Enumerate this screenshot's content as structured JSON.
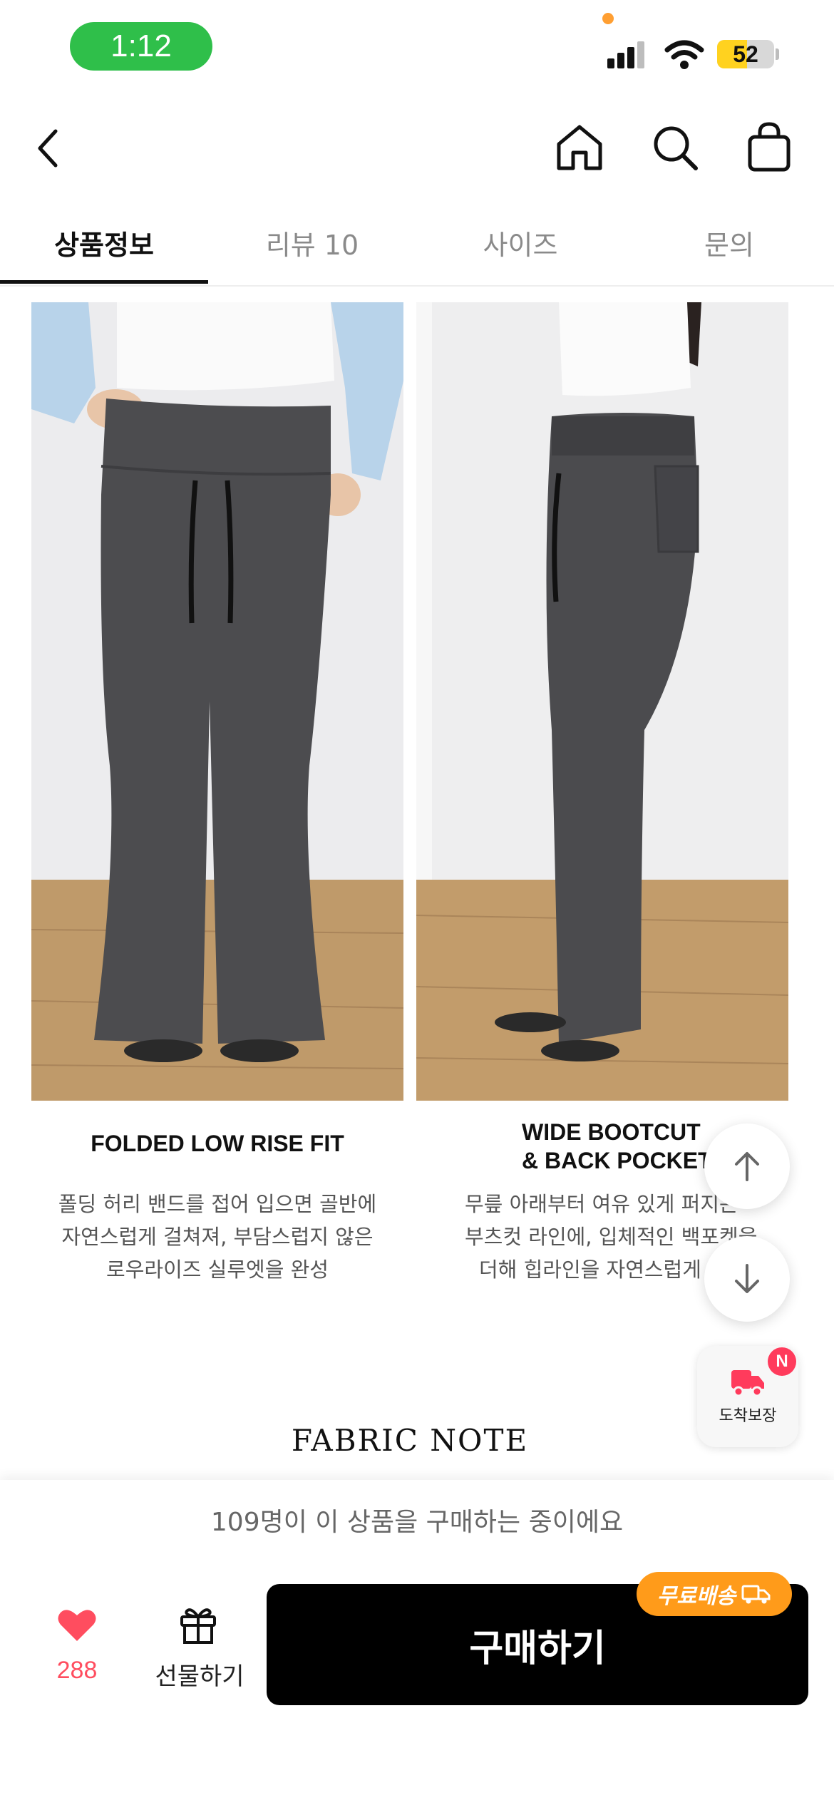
{
  "status_bar": {
    "time": "1:12",
    "battery": "52",
    "battery_level": 0.52,
    "icons": [
      "signal-icon",
      "wifi-icon",
      "battery-icon"
    ]
  },
  "header": {
    "icons": [
      "back-icon",
      "home-icon",
      "search-icon",
      "bag-icon"
    ]
  },
  "tabs": [
    {
      "label": "상품정보",
      "active": true
    },
    {
      "label": "리뷰 10",
      "active": false
    },
    {
      "label": "사이즈",
      "active": false
    },
    {
      "label": "문의",
      "active": false
    }
  ],
  "features": [
    {
      "title": "FOLDED LOW RISE FIT",
      "desc": [
        "폴딩 허리 밴드를 접어 입으면 골반에",
        "자연스럽게 걸쳐져, 부담스럽지 않은",
        "로우라이즈 실루엣을 완성"
      ]
    },
    {
      "title_lines": [
        "WIDE BOOTCUT",
        "& BACK POCKET"
      ],
      "desc": [
        "무릎 아래부터 여유 있게 퍼지는",
        "부츠컷 라인에, 입체적인 백포켓을",
        "더해 힙라인을 자연스럽게"
      ]
    }
  ],
  "floating": {
    "arrival_label": "도착보장",
    "new_badge": "N"
  },
  "section_title": "FABRIC NOTE",
  "bottom": {
    "buying_now": "109명이 이 상품을 구매하는 중이에요",
    "like_count": "288",
    "gift_label": "선물하기",
    "buy_label": "구매하기",
    "free_shipping": "무료배송"
  },
  "colors": {
    "accent_green": "#2fbf4a",
    "heart": "#ff4d5f",
    "free_shipping": "#ff9b1a",
    "badge": "#ff3b5c"
  }
}
